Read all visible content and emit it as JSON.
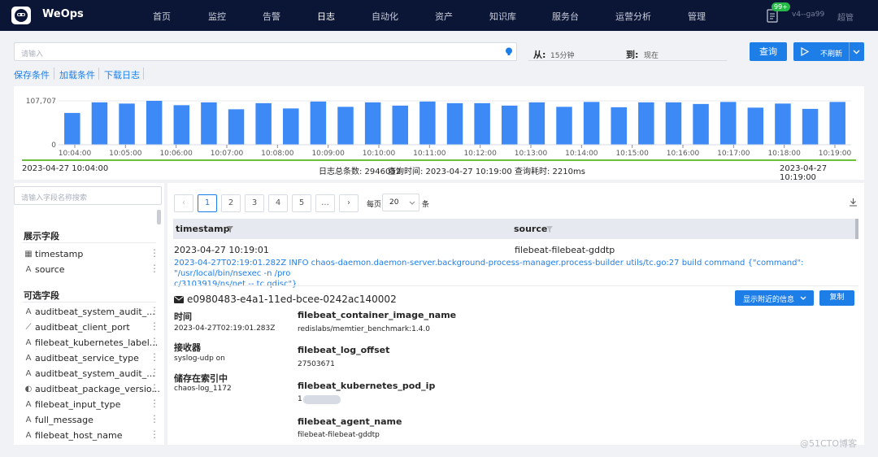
{
  "nav": {
    "brand": "WeOps",
    "items": [
      "首页",
      "监控",
      "告警",
      "日志",
      "自动化",
      "资产",
      "知识库",
      "服务台",
      "运营分析",
      "管理"
    ],
    "active": "日志",
    "badge": "99+",
    "version": "v4--ga99",
    "user": "超管"
  },
  "search": {
    "placeholder": "请输入"
  },
  "time": {
    "from_label": "从:",
    "from_value": "15分钟",
    "to_label": "到:",
    "to_value": "现在"
  },
  "buttons": {
    "query": "查询",
    "refresh": "不刷新"
  },
  "actions": [
    "保存条件",
    "加载条件",
    "下载日志"
  ],
  "chart_data": {
    "type": "bar",
    "ylim": [
      0,
      107707
    ],
    "y_ticks": [
      "107,707",
      "0"
    ],
    "x_ticks": [
      "10:04:00",
      "10:05:00",
      "10:06:00",
      "10:07:00",
      "10:08:00",
      "10:09:00",
      "10:10:00",
      "10:11:00",
      "10:12:00",
      "10:13:00",
      "10:14:00",
      "10:15:00",
      "10:16:00",
      "10:17:00",
      "10:18:00",
      "10:19:00"
    ],
    "values": [
      78000,
      104000,
      101000,
      107707,
      97000,
      104000,
      87000,
      102000,
      89000,
      106000,
      93000,
      104000,
      96000,
      106000,
      102000,
      102000,
      96000,
      104000,
      93000,
      105000,
      92000,
      104000,
      104000,
      100000,
      105000,
      91000,
      101000,
      88000,
      105000
    ]
  },
  "chart_footer": {
    "start": "2023-04-27 10:04:00",
    "total": "日志总条数: 2946052",
    "query_time": "查询时间: 2023-04-27 10:19:00",
    "elapsed": "查询耗时: 2210ms",
    "end": "2023-04-27 10:19:00"
  },
  "fields": {
    "search_placeholder": "请输入字段名称搜索",
    "shown_title": "展示字段",
    "shown": [
      {
        "name": "timestamp",
        "icon": "calendar-icon"
      },
      {
        "name": "source",
        "icon": "text-icon"
      }
    ],
    "available_title": "可选字段",
    "available": [
      {
        "name": "auditbeat_system_audit_...",
        "icon": "text-icon"
      },
      {
        "name": "auditbeat_client_port",
        "icon": "number-icon"
      },
      {
        "name": "filebeat_kubernetes_label...",
        "icon": "text-icon"
      },
      {
        "name": "auditbeat_service_type",
        "icon": "text-icon"
      },
      {
        "name": "auditbeat_system_audit_...",
        "icon": "text-icon"
      },
      {
        "name": "auditbeat_package_versio...",
        "icon": "toggle-icon"
      },
      {
        "name": "filebeat_input_type",
        "icon": "text-icon"
      },
      {
        "name": "full_message",
        "icon": "text-icon"
      },
      {
        "name": "filebeat_host_name",
        "icon": "text-icon"
      }
    ]
  },
  "pagination": {
    "pages": [
      "1",
      "2",
      "3",
      "4",
      "5",
      "..."
    ],
    "per_page_label": "每页",
    "per_page": "20",
    "unit": "条"
  },
  "table": {
    "columns": [
      "timestamp",
      "source"
    ],
    "row": {
      "timestamp": "2023-04-27 10:19:01",
      "source": "filebeat-filebeat-gddtp",
      "message_line1": "2023-04-27T02:19:01.282Z INFO chaos-daemon.daemon-server.background-process-manager.process-builder utils/tc.go:27 build command {\"command\": \"/usr/local/bin/nsexec -n /pro",
      "message_line2": "c/3103919/ns/net -- tc qdisc\"}"
    }
  },
  "detail": {
    "doc_id": "e0980483-e4a1-11ed-bcee-0242ac140002",
    "near_button": "显示附近的信息",
    "copy_button": "复制",
    "time_label": "时间",
    "time_value": "2023-04-27T02:19:01.283Z",
    "receiver_label": "接收器",
    "receiver_value": "syslog-udp on",
    "index_label": "储存在索引中",
    "index_value": "chaos-log_1172",
    "fields": [
      {
        "key": "filebeat_container_image_name",
        "value": "redislabs/memtier_benchmark:1.4.0"
      },
      {
        "key": "filebeat_log_offset",
        "value": "27503671"
      },
      {
        "key": "filebeat_kubernetes_pod_ip",
        "value": "1            0"
      },
      {
        "key": "filebeat_agent_name",
        "value": "filebeat-filebeat-gddtp"
      }
    ]
  },
  "watermark": "@51CTO博客"
}
